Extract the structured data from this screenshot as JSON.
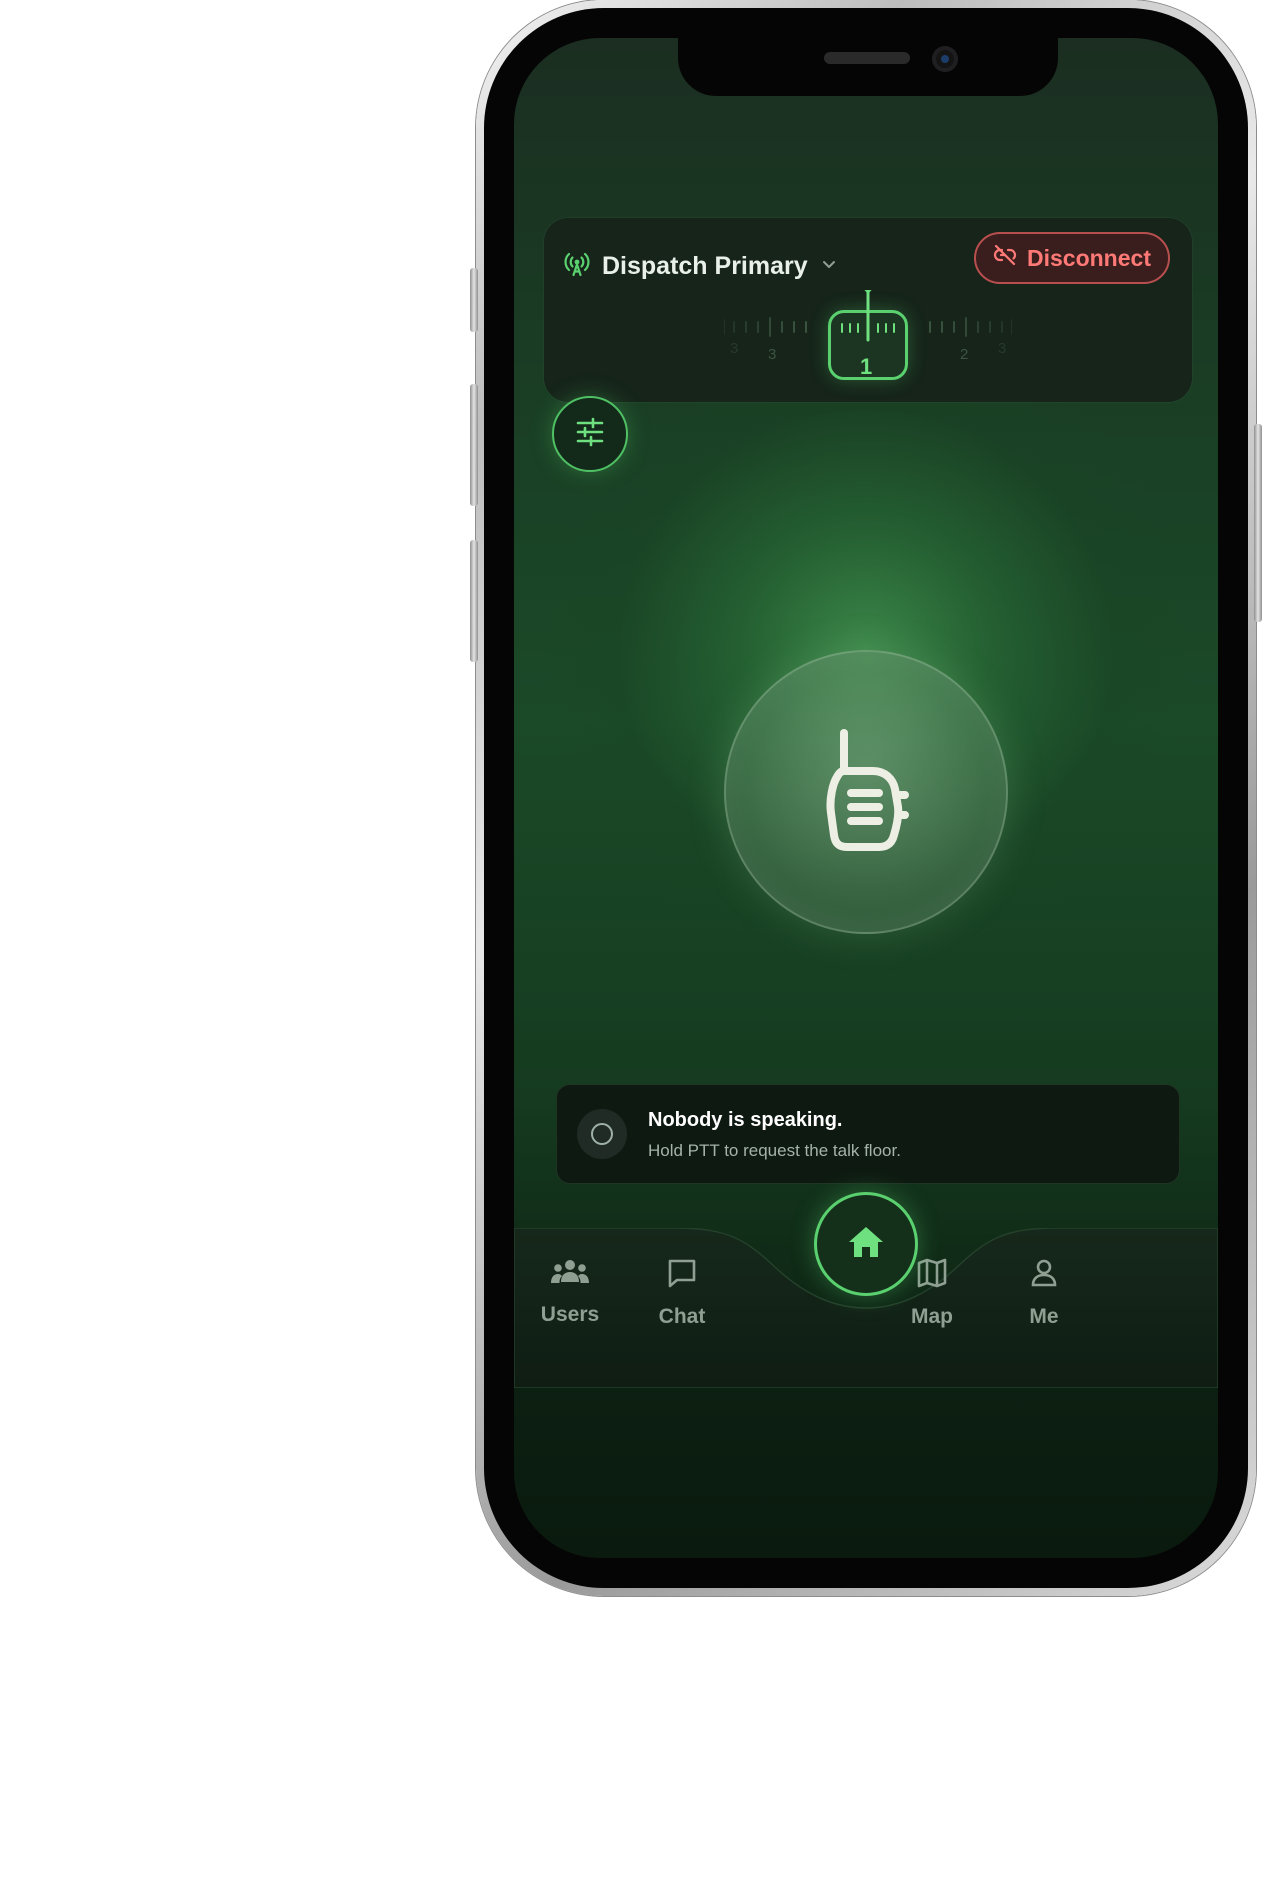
{
  "channel": {
    "name": "Dispatch Primary",
    "disconnect_label": "Disconnect",
    "tuner": {
      "active": "1",
      "left_numbers": [
        "3",
        "3"
      ],
      "right_numbers": [
        "2",
        "3"
      ]
    }
  },
  "status": {
    "title": "Nobody is speaking.",
    "subtitle": "Hold PTT to request the talk floor."
  },
  "nav": {
    "items": [
      {
        "label": "Users",
        "icon": "users-icon"
      },
      {
        "label": "Chat",
        "icon": "chat-icon"
      },
      {
        "label": "Map",
        "icon": "map-icon"
      },
      {
        "label": "Me",
        "icon": "person-icon"
      }
    ],
    "center_icon": "home-icon"
  },
  "colors": {
    "accent": "#5ad06f",
    "danger": "#ff7a76",
    "background": "#1b4a28"
  }
}
